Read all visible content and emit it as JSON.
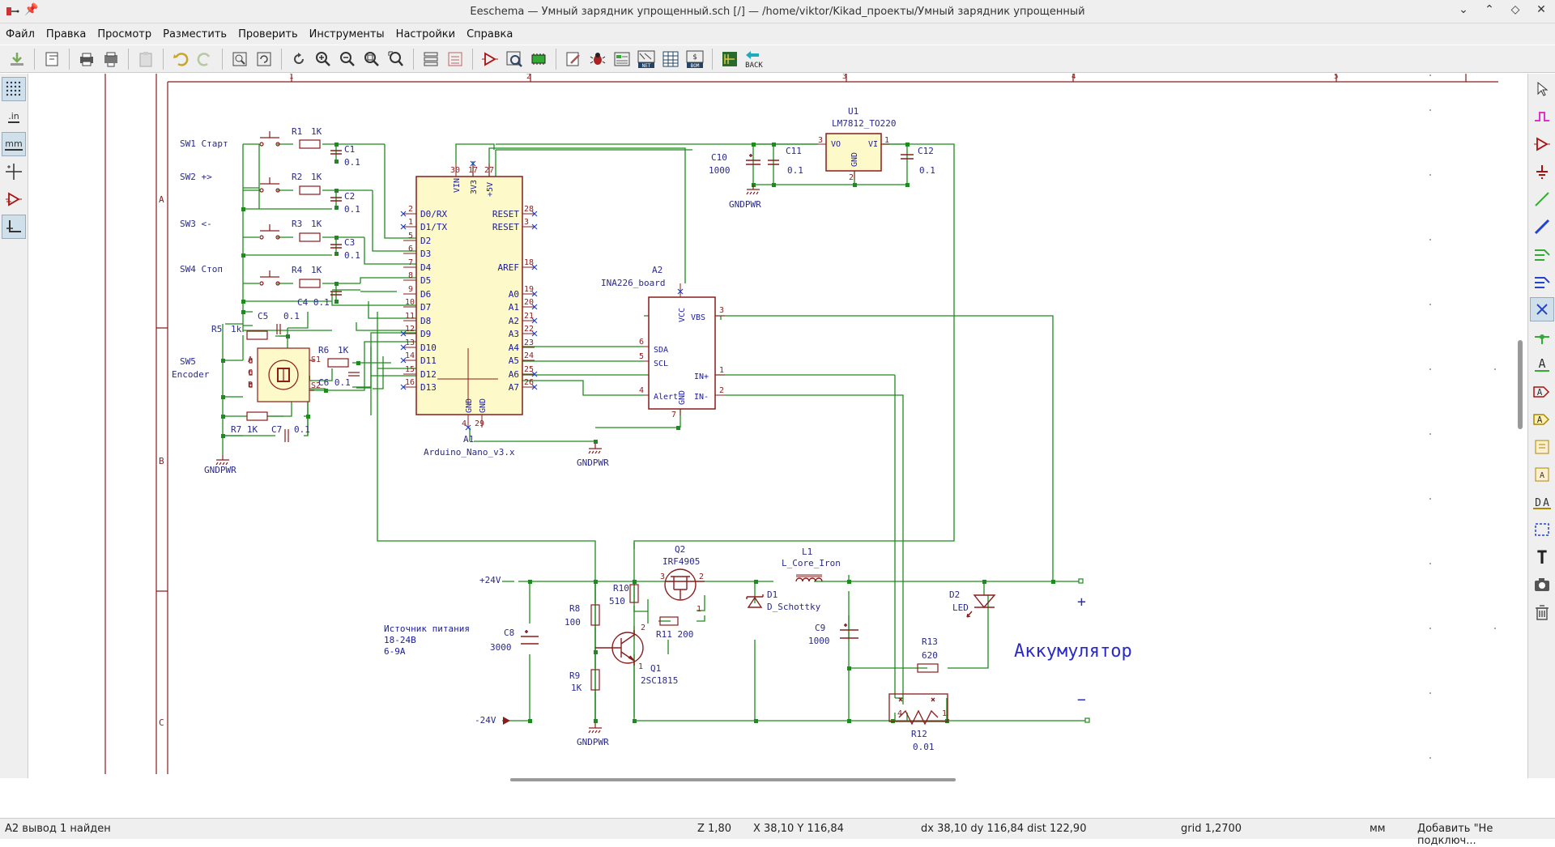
{
  "window": {
    "title": "Eeschema — Умный зарядник упрощенный.sch [/] — /home/viktor/Kikad_проекты/Умный зарядник упрощенный"
  },
  "menu": [
    "Файл",
    "Правка",
    "Просмотр",
    "Разместить",
    "Проверить",
    "Инструменты",
    "Настройки",
    "Справка"
  ],
  "left_tools": {
    "in": ".in",
    "mm": "mm"
  },
  "toolbar_labels": {
    "net": "NET",
    "bom": "BOM",
    "back": "BACK"
  },
  "status": {
    "message": "A2 вывод 1 найден",
    "zoom": "Z 1,80",
    "coords": "X 38,10  Y 116,84",
    "delta": "dx 38,10  dy 116,84  dist 122,90",
    "grid": "grid 1,2700",
    "units": "мм",
    "action": "Добавить \"Не подключ..."
  },
  "schematic": {
    "border_rows": [
      "A",
      "B",
      "C"
    ],
    "border_cols": [
      "1",
      "2",
      "3",
      "4",
      "5"
    ],
    "switches": [
      "SW1 Старт",
      "SW2 +>",
      "SW3 <-",
      "SW4 Стоп"
    ],
    "sw5": [
      "SW5",
      "Encoder"
    ],
    "resistors_left": [
      [
        "R1",
        "1K"
      ],
      [
        "R2",
        "1K"
      ],
      [
        "R3",
        "1K"
      ],
      [
        "R4",
        "1K"
      ]
    ],
    "caps_left": [
      [
        "C1",
        "0.1"
      ],
      [
        "C2",
        "0.1"
      ],
      [
        "C3",
        "0.1"
      ]
    ],
    "c4": "C4 0.1",
    "c5": [
      "C5",
      "0.1"
    ],
    "r5": [
      "R5",
      "1k"
    ],
    "r6": [
      "R6",
      "1K"
    ],
    "c6": "C6 0.1",
    "r7": "R7 1K",
    "c7": [
      "C7",
      "0.1"
    ],
    "encoder_pins": [
      "A",
      "C",
      "B",
      "S1",
      "S2"
    ],
    "gndpwr": "GNDPWR",
    "arduino": {
      "ref": "A1",
      "value": "Arduino_Nano_v3.x",
      "left_pins": [
        [
          "2",
          "D0/RX"
        ],
        [
          "1",
          "D1/TX"
        ],
        [
          "5",
          "D2"
        ],
        [
          "6",
          "D3"
        ],
        [
          "7",
          "D4"
        ],
        [
          "8",
          "D5"
        ],
        [
          "9",
          "D6"
        ],
        [
          "10",
          "D7"
        ],
        [
          "11",
          "D8"
        ],
        [
          "12",
          "D9"
        ],
        [
          "13",
          "D10"
        ],
        [
          "14",
          "D11"
        ],
        [
          "15",
          "D12"
        ],
        [
          "16",
          "D13"
        ]
      ],
      "right_pins": [
        [
          "28",
          "RESET"
        ],
        [
          "3",
          "RESET"
        ],
        [
          "18",
          "AREF"
        ],
        [
          "19",
          "A0"
        ],
        [
          "20",
          "A1"
        ],
        [
          "21",
          "A2"
        ],
        [
          "22",
          "A3"
        ],
        [
          "23",
          "A4"
        ],
        [
          "24",
          "A5"
        ],
        [
          "25",
          "A6"
        ],
        [
          "26",
          "A7"
        ]
      ],
      "top_pins": [
        [
          "30",
          "VIN"
        ],
        [
          "17",
          "3V3"
        ],
        [
          "27",
          "+5V"
        ]
      ],
      "bottom_pins": [
        [
          "4",
          "GND"
        ],
        [
          "29",
          "GND"
        ]
      ]
    },
    "ina": {
      "ref": "A2",
      "value": "INA226_board",
      "pins_left": [
        [
          "6",
          "SDA"
        ],
        [
          "5",
          "SCL"
        ],
        [
          "4",
          "Alert"
        ]
      ],
      "pins_right": [
        [
          "3",
          "VBS"
        ],
        [
          "1",
          "IN+"
        ],
        [
          "2",
          "IN-"
        ]
      ],
      "top": [
        "8",
        "VCC"
      ],
      "bottom": [
        "7",
        "GND"
      ]
    },
    "regulator": {
      "ref": "U1",
      "value": "LM7812_TO220",
      "pin_in": "VI",
      "pin_out": "VO",
      "pin_gnd": "GND",
      "pins": [
        "3",
        "1",
        "2"
      ]
    },
    "c10": [
      "C10",
      "1000"
    ],
    "c11": [
      "C11",
      "0.1"
    ],
    "c12": [
      "C12",
      "0.1"
    ],
    "power": {
      "p24": "+24V",
      "n24": "-24V"
    },
    "source_note": [
      "Источник питания",
      "18-24В",
      "6-9А"
    ],
    "c8": [
      "C8",
      "3000"
    ],
    "r8": [
      "R8",
      "100"
    ],
    "r9": [
      "R9",
      "1K"
    ],
    "r10": [
      "R10",
      "510"
    ],
    "r11": "R11  200",
    "q1": [
      "Q1",
      "2SC1815"
    ],
    "q2": [
      "Q2",
      "IRF4905"
    ],
    "l1": [
      "L1",
      "L_Core_Iron"
    ],
    "d1": [
      "D1",
      "D_Schottky"
    ],
    "c9": [
      "C9",
      "1000"
    ],
    "d2": [
      "D2",
      "LED"
    ],
    "r13": [
      "R13",
      "620"
    ],
    "r12": [
      "R12",
      "0.01"
    ],
    "battery_label": "Аккумулятор",
    "plus": "+",
    "minus": "−"
  }
}
